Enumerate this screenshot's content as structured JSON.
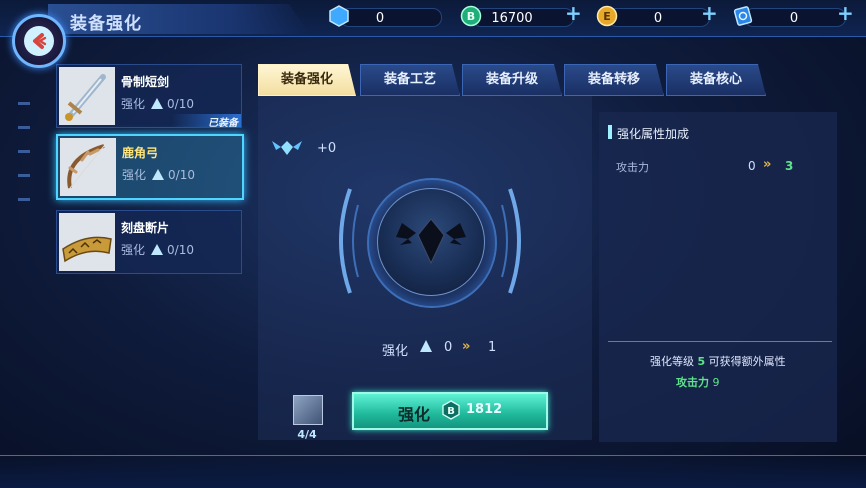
{
  "header": {
    "title": "装备强化",
    "resources": [
      {
        "icon": "blue-gem-icon",
        "value": "0",
        "has_plus": false
      },
      {
        "icon": "green-coin-icon",
        "value": "16700",
        "has_plus": true
      },
      {
        "icon": "gold-coin-icon",
        "value": "0",
        "has_plus": true
      },
      {
        "icon": "blue-card-icon",
        "value": "0",
        "has_plus": true
      }
    ]
  },
  "items": [
    {
      "name": "骨制短剑",
      "level_label": "强化",
      "level": "0/10",
      "equipped_label": "已装备",
      "icon": "bone-dagger-icon"
    },
    {
      "name": "鹿角弓",
      "level_label": "强化",
      "level": "0/10",
      "icon": "antler-bow-icon"
    },
    {
      "name": "刻盘断片",
      "level_label": "强化",
      "level": "0/10",
      "icon": "carved-tablet-icon"
    }
  ],
  "tabs": [
    "装备强化",
    "装备工艺",
    "装备升级",
    "装备转移",
    "装备核心"
  ],
  "main": {
    "gem_bonus": "+0",
    "level_label": "强化",
    "level_from": "0",
    "level_to": "1",
    "button_label": "强化",
    "button_cost": "1812",
    "material_count": "4/4"
  },
  "attributes": {
    "title": "强化属性加成",
    "rows": [
      {
        "name": "攻击力",
        "from": "0",
        "to": "3"
      }
    ],
    "bonus_line_prefix": "强化等级",
    "bonus_level": "5",
    "bonus_line_suffix": "可获得额外属性",
    "bonus_attr_name": "攻击力",
    "bonus_attr_value": "9"
  },
  "colors": {
    "accent": "#4fd6ff",
    "button": "#1fb89b",
    "highlight": "#ffe47a",
    "green_text": "#5fe38a"
  }
}
